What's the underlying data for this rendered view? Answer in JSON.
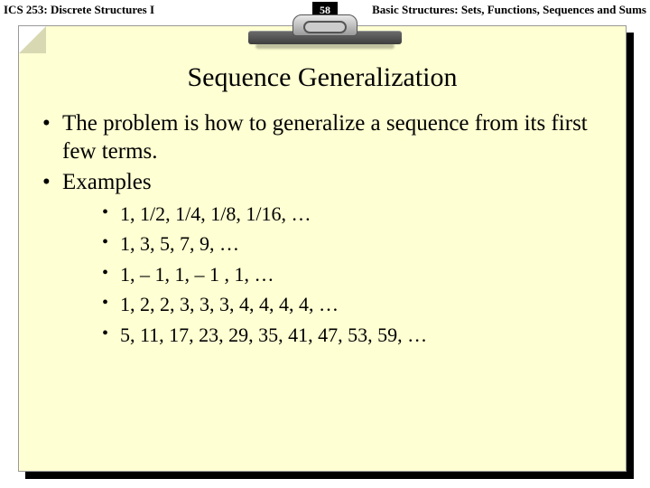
{
  "header": {
    "left": "ICS 253: Discrete Structures I",
    "right": "Basic Structures: Sets, Functions, Sequences and Sums",
    "page_number": "58"
  },
  "slide": {
    "title": "Sequence Generalization",
    "bullets": {
      "b1": "The problem is how to generalize a sequence from its first few terms.",
      "b2": "Examples"
    },
    "examples": {
      "e1": "1, 1/2, 1/4, 1/8, 1/16, …",
      "e2": "1, 3, 5, 7, 9, …",
      "e3": "1, – 1, 1, – 1 , 1, …",
      "e4": "1, 2, 2, 3, 3, 3, 4, 4, 4, 4, …",
      "e5": "5, 11, 17, 23, 29, 35, 41, 47, 53, 59, …"
    }
  }
}
